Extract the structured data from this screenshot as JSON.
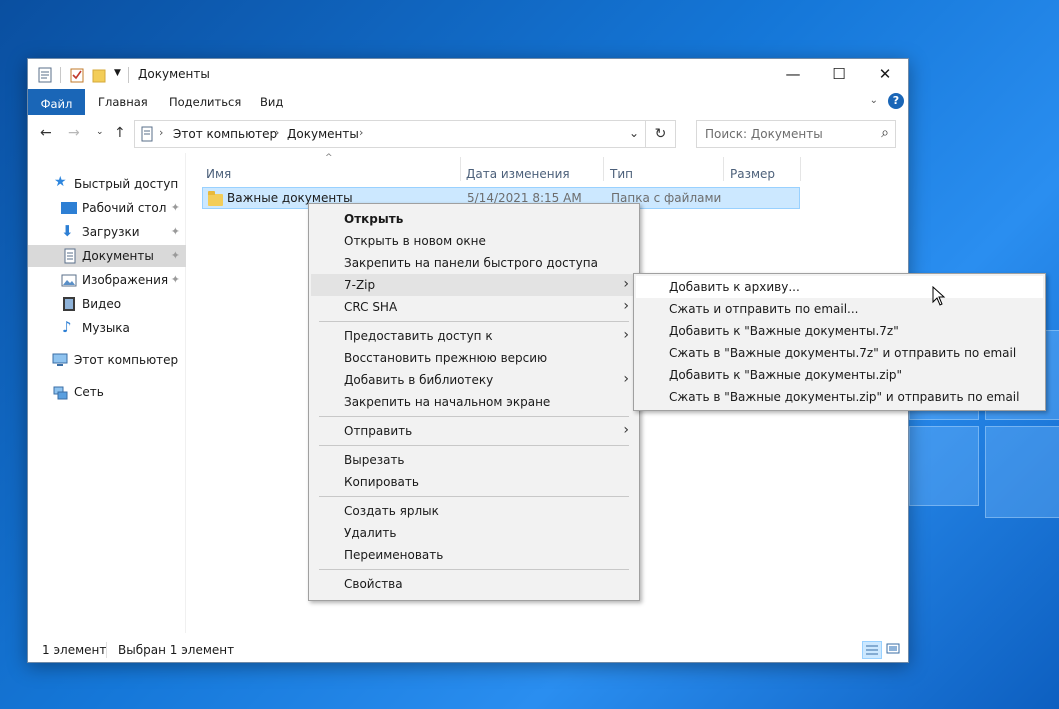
{
  "window": {
    "title": "Документы",
    "controls": {
      "minimize": "—",
      "maximize": "☐",
      "close": "✕"
    }
  },
  "ribbon": {
    "tabs": [
      "Файл",
      "Главная",
      "Поделиться",
      "Вид"
    ],
    "help": "?"
  },
  "address": {
    "crumbs": [
      "Этот компьютер",
      "Документы"
    ],
    "search_placeholder": "Поиск: Документы"
  },
  "sidebar": {
    "items": [
      {
        "label": "Быстрый доступ",
        "icon": "star-icon",
        "pinned": false
      },
      {
        "label": "Рабочий стол",
        "icon": "desktop-icon",
        "pinned": true
      },
      {
        "label": "Загрузки",
        "icon": "download-icon",
        "pinned": true
      },
      {
        "label": "Документы",
        "icon": "document-icon",
        "pinned": true
      },
      {
        "label": "Изображения",
        "icon": "pictures-icon",
        "pinned": true
      },
      {
        "label": "Видео",
        "icon": "video-icon",
        "pinned": false
      },
      {
        "label": "Музыка",
        "icon": "music-icon",
        "pinned": false
      },
      {
        "label": "Этот компьютер",
        "icon": "computer-icon",
        "pinned": false
      },
      {
        "label": "Сеть",
        "icon": "network-icon",
        "pinned": false
      }
    ]
  },
  "columns": {
    "name": "Имя",
    "date": "Дата изменения",
    "type": "Тип",
    "size": "Размер"
  },
  "files": [
    {
      "name": "Важные документы",
      "date": "5/14/2021 8:15 AM",
      "type": "Папка с файлами",
      "size": ""
    }
  ],
  "status": {
    "count": "1 элемент",
    "selected": "Выбран 1 элемент"
  },
  "context_menu": {
    "items": [
      "Открыть",
      "Открыть в новом окне",
      "Закрепить на панели быстрого доступа",
      "7-Zip",
      "CRC SHA",
      "Предоставить доступ к",
      "Восстановить прежнюю версию",
      "Добавить в библиотеку",
      "Закрепить на начальном экране",
      "Отправить",
      "Вырезать",
      "Копировать",
      "Создать ярлык",
      "Удалить",
      "Переименовать",
      "Свойства"
    ]
  },
  "submenu_7zip": {
    "items": [
      "Добавить к архиву...",
      "Сжать и отправить по email...",
      "Добавить к \"Важные документы.7z\"",
      "Сжать в \"Важные документы.7z\" и отправить по email",
      "Добавить к \"Важные документы.zip\"",
      "Сжать в \"Важные документы.zip\" и отправить по email"
    ]
  },
  "colors": {
    "accent": "#1a66b7",
    "selection": "#cce8ff",
    "folder": "#f3cd58"
  }
}
